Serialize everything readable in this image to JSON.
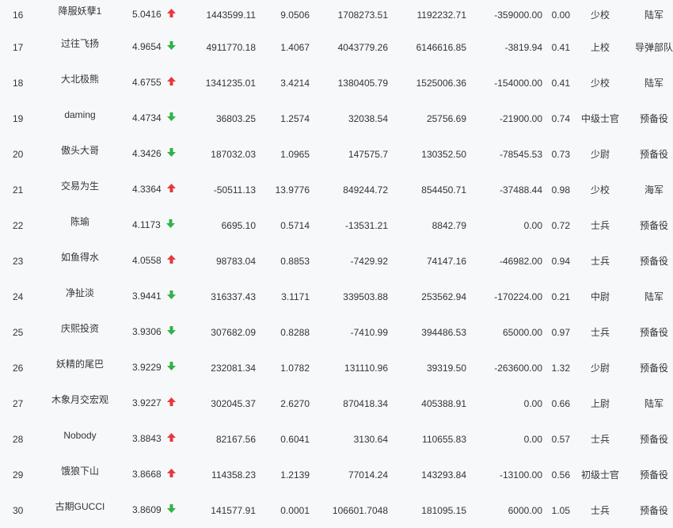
{
  "colors": {
    "up": "#e8373b",
    "down": "#2fb34a",
    "background": "#f7f8fa",
    "text": "#333333"
  },
  "icons": {
    "up": "red-up-arrow-icon",
    "down": "green-down-arrow-icon"
  },
  "rows": [
    {
      "rank": "16",
      "name": "降服妖孽1",
      "score": "5.0416",
      "trend": "up",
      "v1": "1443599.11",
      "v2": "9.0506",
      "v3": "1708273.51",
      "v4": "1192232.71",
      "v5": "-359000.00",
      "v6": "0.00",
      "mil_rank": "少校",
      "branch": "陆军"
    },
    {
      "rank": "17",
      "name": "过往飞扬",
      "score": "4.9654",
      "trend": "down",
      "v1": "4911770.18",
      "v2": "1.4067",
      "v3": "4043779.26",
      "v4": "6146616.85",
      "v5": "-3819.94",
      "v6": "0.41",
      "mil_rank": "上校",
      "branch": "导弹部队"
    },
    {
      "rank": "18",
      "name": "大北极熊",
      "score": "4.6755",
      "trend": "up",
      "v1": "1341235.01",
      "v2": "3.4214",
      "v3": "1380405.79",
      "v4": "1525006.36",
      "v5": "-154000.00",
      "v6": "0.41",
      "mil_rank": "少校",
      "branch": "陆军"
    },
    {
      "rank": "19",
      "name": "daming",
      "score": "4.4734",
      "trend": "down",
      "v1": "36803.25",
      "v2": "1.2574",
      "v3": "32038.54",
      "v4": "25756.69",
      "v5": "-21900.00",
      "v6": "0.74",
      "mil_rank": "中级士官",
      "branch": "预备役"
    },
    {
      "rank": "20",
      "name": "傲头大哥",
      "score": "4.3426",
      "trend": "down",
      "v1": "187032.03",
      "v2": "1.0965",
      "v3": "147575.7",
      "v4": "130352.50",
      "v5": "-78545.53",
      "v6": "0.73",
      "mil_rank": "少尉",
      "branch": "预备役"
    },
    {
      "rank": "21",
      "name": "交易为生",
      "score": "4.3364",
      "trend": "up",
      "v1": "-50511.13",
      "v2": "13.9776",
      "v3": "849244.72",
      "v4": "854450.71",
      "v5": "-37488.44",
      "v6": "0.98",
      "mil_rank": "少校",
      "branch": "海军"
    },
    {
      "rank": "22",
      "name": "陈瑜",
      "score": "4.1173",
      "trend": "down",
      "v1": "6695.10",
      "v2": "0.5714",
      "v3": "-13531.21",
      "v4": "8842.79",
      "v5": "0.00",
      "v6": "0.72",
      "mil_rank": "士兵",
      "branch": "预备役"
    },
    {
      "rank": "23",
      "name": "如鱼得水",
      "score": "4.0558",
      "trend": "up",
      "v1": "98783.04",
      "v2": "0.8853",
      "v3": "-7429.92",
      "v4": "74147.16",
      "v5": "-46982.00",
      "v6": "0.94",
      "mil_rank": "士兵",
      "branch": "预备役"
    },
    {
      "rank": "24",
      "name": "净扯淡",
      "score": "3.9441",
      "trend": "down",
      "v1": "316337.43",
      "v2": "3.1171",
      "v3": "339503.88",
      "v4": "253562.94",
      "v5": "-170224.00",
      "v6": "0.21",
      "mil_rank": "中尉",
      "branch": "陆军"
    },
    {
      "rank": "25",
      "name": "庆熙投资",
      "score": "3.9306",
      "trend": "down",
      "v1": "307682.09",
      "v2": "0.8288",
      "v3": "-7410.99",
      "v4": "394486.53",
      "v5": "65000.00",
      "v6": "0.97",
      "mil_rank": "士兵",
      "branch": "预备役"
    },
    {
      "rank": "26",
      "name": "妖精的尾巴",
      "score": "3.9229",
      "trend": "down",
      "v1": "232081.34",
      "v2": "1.0782",
      "v3": "131110.96",
      "v4": "39319.50",
      "v5": "-263600.00",
      "v6": "1.32",
      "mil_rank": "少尉",
      "branch": "预备役"
    },
    {
      "rank": "27",
      "name": "木象月交宏观",
      "score": "3.9227",
      "trend": "up",
      "v1": "302045.37",
      "v2": "2.6270",
      "v3": "870418.34",
      "v4": "405388.91",
      "v5": "0.00",
      "v6": "0.66",
      "mil_rank": "上尉",
      "branch": "陆军"
    },
    {
      "rank": "28",
      "name": "Nobody",
      "score": "3.8843",
      "trend": "up",
      "v1": "82167.56",
      "v2": "0.6041",
      "v3": "3130.64",
      "v4": "110655.83",
      "v5": "0.00",
      "v6": "0.57",
      "mil_rank": "士兵",
      "branch": "预备役"
    },
    {
      "rank": "29",
      "name": "饿狼下山",
      "score": "3.8668",
      "trend": "up",
      "v1": "114358.23",
      "v2": "1.2139",
      "v3": "77014.24",
      "v4": "143293.84",
      "v5": "-13100.00",
      "v6": "0.56",
      "mil_rank": "初级士官",
      "branch": "预备役"
    },
    {
      "rank": "30",
      "name": "古期GUCCI",
      "score": "3.8609",
      "trend": "down",
      "v1": "141577.91",
      "v2": "0.0001",
      "v3": "106601.7048",
      "v4": "181095.15",
      "v5": "6000.00",
      "v6": "1.05",
      "mil_rank": "士兵",
      "branch": "预备役"
    }
  ]
}
